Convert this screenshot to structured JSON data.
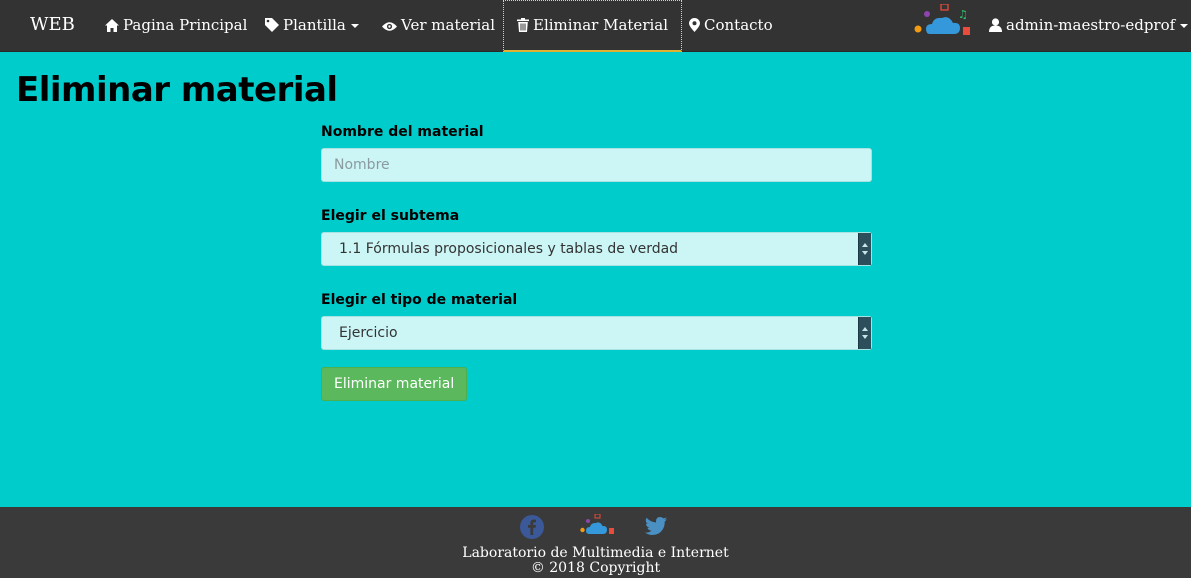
{
  "navbar": {
    "brand": "WEB",
    "items": [
      {
        "label": "Pagina Principal",
        "icon": "home-icon"
      },
      {
        "label": "Plantilla",
        "icon": "tag-icon",
        "dropdown": true
      },
      {
        "label": "Ver material",
        "icon": "eye-icon"
      },
      {
        "label": "Eliminar Material",
        "icon": "trash-icon",
        "active": true
      },
      {
        "label": "Contacto",
        "icon": "map-marker-icon"
      }
    ],
    "user": {
      "label": "admin-maestro-edprof",
      "icon": "user-icon",
      "dropdown": true
    }
  },
  "main": {
    "title": "Eliminar material",
    "form": {
      "name_label": "Nombre del material",
      "name_placeholder": "Nombre",
      "name_value": "",
      "subtopic_label": "Elegir el subtema",
      "subtopic_selected": "1.1 Fórmulas proposicionales y tablas de verdad",
      "type_label": "Elegir el tipo de material",
      "type_selected": "Ejercicio",
      "submit_label": "Eliminar material"
    }
  },
  "footer": {
    "icons": [
      "facebook-icon",
      "cloud-logo-icon",
      "twitter-icon"
    ],
    "line1": "Laboratorio de Multimedia e Internet",
    "line2": "© 2018 Copyright"
  },
  "colors": {
    "page_background": "#00cccc",
    "navbar_background": "#333333",
    "footer_background": "#3a3a3a",
    "input_background": "#ccf5f5",
    "button_success": "#5cb85c",
    "active_underline": "#e0b030"
  }
}
